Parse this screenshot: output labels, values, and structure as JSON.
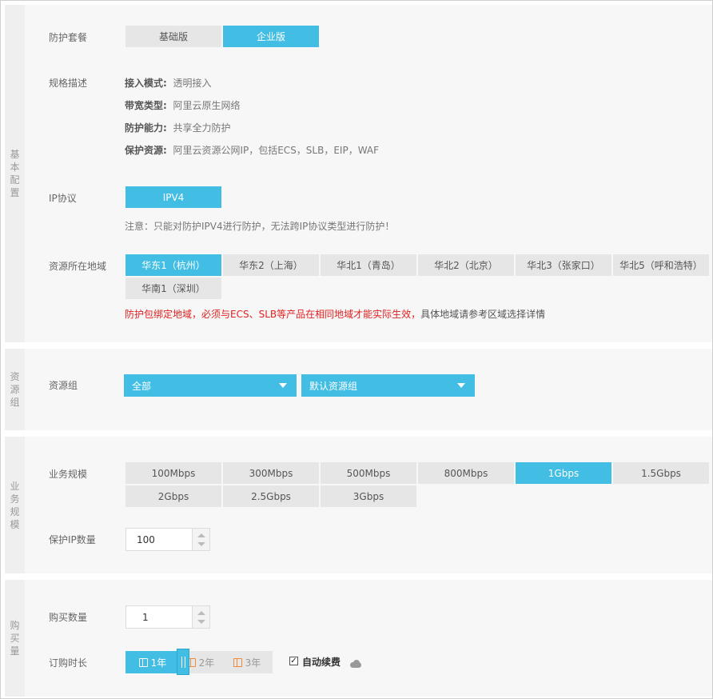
{
  "sections": {
    "basic": "基本配置",
    "resource_group": "资源组",
    "business": "业务规模",
    "purchase": "购买量"
  },
  "package": {
    "label": "防护套餐",
    "options": [
      "基础版",
      "企业版"
    ],
    "selected": "企业版"
  },
  "spec": {
    "label": "规格描述",
    "items": [
      {
        "k": "接入模式:",
        "v": "透明接入"
      },
      {
        "k": "带宽类型:",
        "v": "阿里云原生网络"
      },
      {
        "k": "防护能力:",
        "v": "共享全力防护"
      },
      {
        "k": "保护资源:",
        "v": "阿里云资源公网IP，包括ECS，SLB，EIP，WAF"
      }
    ]
  },
  "ip": {
    "label": "IP协议",
    "option": "IPV4",
    "note": "注意：只能对防护IPV4进行防护，无法跨IP协议类型进行防护！"
  },
  "region": {
    "label": "资源所在地域",
    "options": [
      "华东1（杭州）",
      "华东2（上海）",
      "华北1（青岛）",
      "华北2（北京）",
      "华北3（张家口）",
      "华北5（呼和浩特）",
      "华南1（深圳）"
    ],
    "selected": "华东1（杭州）",
    "warning": "防护包绑定地域，必须与ECS、SLB等产品在相同地域才能实际生效，",
    "warning_tail": "具体地域请参考区域选择详情"
  },
  "resource_group": {
    "label": "资源组",
    "first": "全部",
    "second": "默认资源组"
  },
  "scale": {
    "label": "业务规模",
    "options": [
      "100Mbps",
      "300Mbps",
      "500Mbps",
      "800Mbps",
      "1Gbps",
      "1.5Gbps",
      "2Gbps",
      "2.5Gbps",
      "3Gbps"
    ],
    "selected": "1Gbps"
  },
  "ip_count": {
    "label": "保护IP数量",
    "value": "100"
  },
  "quantity": {
    "label": "购买数量",
    "value": "1"
  },
  "duration": {
    "label": "订购时长",
    "options": [
      "1年",
      "2年",
      "3年"
    ],
    "selected": "1年",
    "auto_renew": "自动续费",
    "auto_renew_checked": true
  },
  "colors": {
    "accent": "#42bde4",
    "warning": "#e02020",
    "segment_bg": "#e6e6e6"
  }
}
